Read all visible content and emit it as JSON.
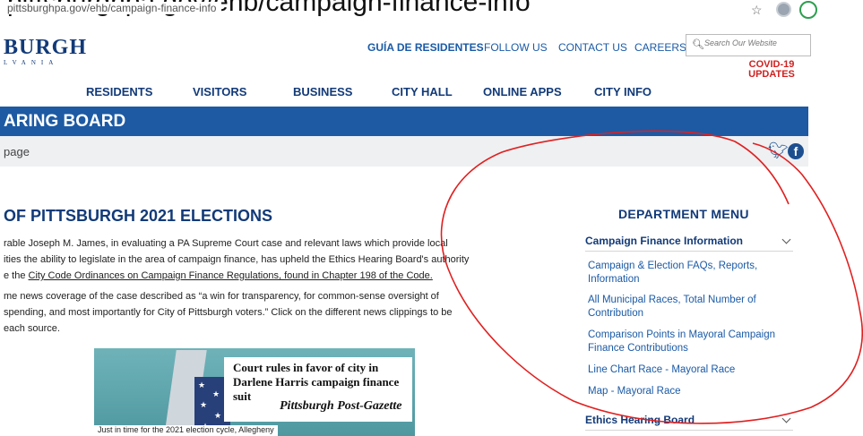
{
  "browser": {
    "overflow_text": "pittsburghpa.gov/ehb/campaign-finance-info",
    "url": "pittsburghpa.gov/ehb/campaign-finance-info"
  },
  "site": {
    "logo": "BURGH",
    "logo_sub": "LVANIA",
    "utility_nav": [
      "GUÍA DE RESIDENTES",
      "FOLLOW US",
      "CONTACT US",
      "CAREERS"
    ],
    "search_placeholder": "Search Our Website",
    "covid_line1": "COVID-19",
    "covid_line2": "UPDATES",
    "main_nav": [
      "RESIDENTS",
      "VISITORS",
      "BUSINESS",
      "CITY HALL",
      "ONLINE APPS",
      "CITY INFO"
    ]
  },
  "band": {
    "title": "ARING BOARD",
    "breadcrumb": "page"
  },
  "content": {
    "heading": "OF PITTSBURGH 2021 ELECTIONS",
    "para1_line1": "rable Joseph M. James, in evaluating a PA Supreme Court case and relevant laws which provide local",
    "para1_line2": "ities the ability to legislate in the area of campaign finance, has upheld the Ethics Hearing Board's authority",
    "para1_line3_prefix": "e the ",
    "para1_link": "City Code Ordinances on Campaign Finance Regulations, found in Chapter 198 of the Code.",
    "para2_line1": "me news coverage of the case described as “a win for transparency, for common-sense oversight of",
    "para2_line2": " spending, and most importantly for City of Pittsburgh voters.” Click on the different news clippings to be",
    "para2_line3": "each source.",
    "clipping": {
      "headline": "Court rules in favor of city in Darlene Harris campaign finance suit",
      "paper": "Pittsburgh Post-Gazette",
      "caption": "Just in time for the 2021 election cycle, Allegheny"
    }
  },
  "department_menu": {
    "heading": "DEPARTMENT MENU",
    "section1": "Campaign Finance Information",
    "links": [
      "Campaign & Election FAQs, Reports, Information",
      "All Municipal Races, Total Number of Contribution",
      "Comparison Points in Mayoral Campaign Finance Contributions",
      "Line Chart Race - Mayoral Race",
      "Map - Mayoral Race"
    ],
    "section2": "Ethics Hearing Board"
  },
  "colors": {
    "brand_blue": "#1d5aa3",
    "link_blue": "#1a5aa6",
    "covid_red": "#d1201f",
    "annotation_red": "#e02020"
  },
  "icons": [
    "star-icon",
    "profile-avatar-icon",
    "extension-icon",
    "search-icon",
    "twitter-icon",
    "facebook-icon",
    "chevron-down-icon"
  ]
}
